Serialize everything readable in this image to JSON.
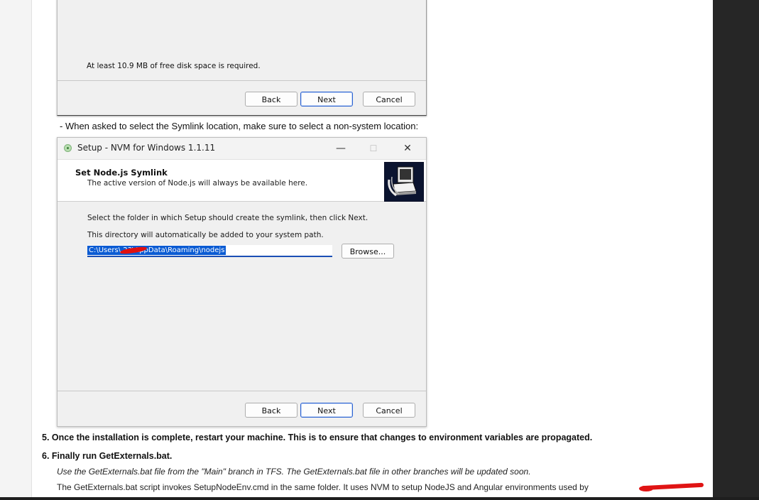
{
  "window1": {
    "disk_space_text": "At least 10.9 MB of free disk space is required.",
    "buttons": {
      "back": "Back",
      "next": "Next",
      "cancel": "Cancel"
    }
  },
  "instruction_symlink": "- When asked to select the Symlink location, make sure to select a non-system location:",
  "window2": {
    "title": "Setup - NVM for Windows 1.1.11",
    "controls": {
      "minimize": "—",
      "maximize": "☐",
      "close": "✕"
    },
    "header_title": "Set Node.js Symlink",
    "header_subtitle": "The active version of Node.js will always be available here.",
    "line1": "Select the folder in which Setup should create the symlink, then click Next.",
    "line2": "This directory will automatically be added to your system path.",
    "path_value": "C:\\Users\\     23\\AppData\\Roaming\\nodejs",
    "browse_label": "Browse...",
    "buttons": {
      "back": "Back",
      "next": "Next",
      "cancel": "Cancel"
    },
    "logo_icon": "computer-setup-icon"
  },
  "step5": "5. Once the installation is complete, restart your machine. This is to ensure that changes to environment variables are propagated.",
  "step6": "6. Finally run GetExternals.bat.",
  "step6_note_italic": "Use the GetExternals.bat file from the \"Main\" branch in TFS. The GetExternals.bat file in other branches will be updated soon.",
  "step6_note": "The GetExternals.bat script invokes SetupNodeEnv.cmd in the same folder. It uses NVM to setup NodeJS and Angular environments used by",
  "colors": {
    "accent": "#1a4fb5",
    "selection": "#0a5bd3",
    "redaction": "#e01010"
  }
}
